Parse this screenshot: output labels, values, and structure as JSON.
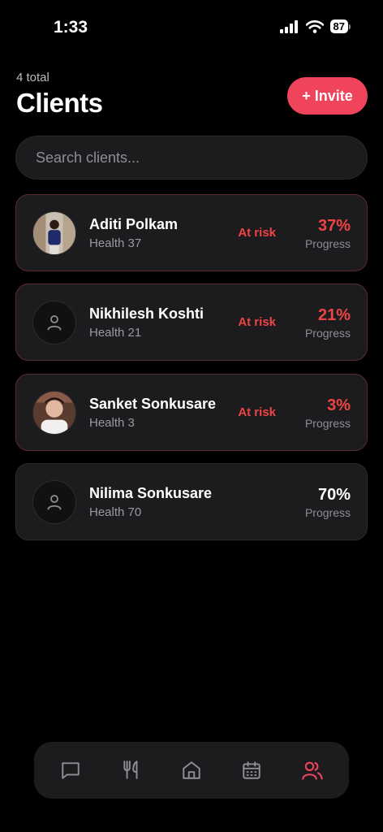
{
  "status": {
    "time": "1:33",
    "battery": "87"
  },
  "header": {
    "total": "4 total",
    "title": "Clients",
    "invite_label": "+ Invite"
  },
  "search": {
    "placeholder": "Search clients..."
  },
  "clients": [
    {
      "name": "Aditi Polkam",
      "health": "Health 37",
      "badge": "At risk",
      "progress": "37%",
      "progress_label": "Progress",
      "progress_value": 37,
      "avatar": "photo"
    },
    {
      "name": "Nikhilesh Koshti",
      "health": "Health 21",
      "badge": "At risk",
      "progress": "21%",
      "progress_label": "Progress",
      "progress_value": 21,
      "avatar": "placeholder"
    },
    {
      "name": "Sanket Sonkusare",
      "health": "Health 3",
      "badge": "At risk",
      "progress": "3%",
      "progress_label": "Progress",
      "progress_value": 3,
      "avatar": "photo"
    },
    {
      "name": "Nilima Sonkusare",
      "health": "Health 70",
      "badge": "",
      "progress": "70%",
      "progress_label": "Progress",
      "progress_value": 70,
      "avatar": "placeholder"
    }
  ],
  "tabs": [
    {
      "icon": "chat-icon",
      "active": false
    },
    {
      "icon": "fork-knife-icon",
      "active": false
    },
    {
      "icon": "home-icon",
      "active": false
    },
    {
      "icon": "calendar-icon",
      "active": false
    },
    {
      "icon": "users-icon",
      "active": true
    }
  ],
  "colors": {
    "accent": "#f0435c",
    "risk": "#f04444",
    "card": "#1c1c1e",
    "background": "#000000"
  }
}
